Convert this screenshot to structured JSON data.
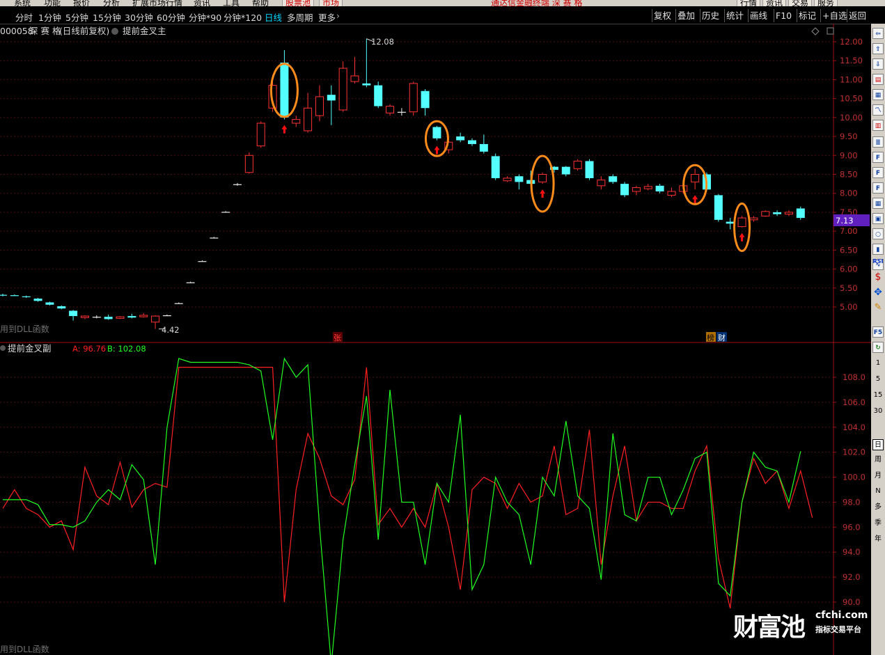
{
  "menu": {
    "items": [
      "系统",
      "功能",
      "报价",
      "分析",
      "扩展市场行情",
      "资讯",
      "工具",
      "帮助"
    ],
    "tab1": "股票池",
    "tab2": "市场",
    "title": "通达信金融终端 深 赛 格",
    "right": [
      "行情",
      "资讯",
      "交易",
      "服务"
    ]
  },
  "toolbar": {
    "periods": [
      "分时",
      "1分钟",
      "5分钟",
      "15分钟",
      "30分钟",
      "60分钟",
      "分钟*90",
      "分钟*120",
      "日线",
      "多周期",
      "更多"
    ],
    "active": "日线",
    "right_buttons": [
      "复权",
      "叠加",
      "历史",
      "统计",
      "画线",
      "F10",
      "标记",
      "+自选",
      "返回"
    ]
  },
  "main_panel": {
    "title_code": "000058",
    "title_name": "深 赛 格",
    "title_mode": "(日线前复权)",
    "indicator": "提前金叉主",
    "high_label": "12.08",
    "low_label": "4.42",
    "current_price": "7.13",
    "corner_text": "用到DLL函数",
    "marker_zhang": "张",
    "marker_bang": "榜",
    "marker_cai": "财"
  },
  "sub_panel": {
    "name": "提前金叉副",
    "a_label": "A: 96.76",
    "b_label": "B: 102.08",
    "corner_text": "用到DLL函数"
  },
  "sidebar": {
    "period_keys": [
      "1",
      "5",
      "15",
      "30",
      "日",
      "周",
      "月",
      "N",
      "多",
      "季",
      "年"
    ],
    "selected": "日",
    "icons": [
      "RSI",
      "F5"
    ]
  },
  "watermark": {
    "brand": "财富池",
    "url": "cfchi.com",
    "slogan": "指标交易平台"
  },
  "colors": {
    "up": "#ff3232",
    "down": "#54ffff",
    "line_a": "#ff2020",
    "line_b": "#20ff20",
    "highlight": "#ff8c1a"
  },
  "chart_data": [
    {
      "type": "candlestick",
      "title": "000058 深 赛 格 (日线前复权) 提前金叉主",
      "y_ticks": [
        "12.00",
        "11.50",
        "11.00",
        "10.50",
        "10.00",
        "9.50",
        "9.00",
        "8.50",
        "8.00",
        "7.50",
        "7.00",
        "6.50",
        "6.00",
        "5.50",
        "5.00"
      ],
      "ylim": [
        4.3,
        12.5
      ],
      "annotations": {
        "max": 12.08,
        "min": 4.42,
        "last": 7.13
      },
      "candles": [
        [
          5.32,
          5.3,
          5.35,
          5.28
        ],
        [
          5.31,
          5.3,
          5.33,
          5.29
        ],
        [
          5.28,
          5.26,
          5.3,
          5.24
        ],
        [
          5.22,
          5.16,
          5.24,
          5.14
        ],
        [
          5.12,
          5.06,
          5.14,
          5.04
        ],
        [
          5.02,
          4.96,
          5.04,
          4.94
        ],
        [
          4.9,
          4.76,
          4.92,
          4.64
        ],
        [
          4.72,
          4.76,
          4.78,
          4.68
        ],
        [
          4.74,
          4.74,
          4.78,
          4.7
        ],
        [
          4.74,
          4.68,
          4.8,
          4.66
        ],
        [
          4.7,
          4.74,
          4.76,
          4.68
        ],
        [
          4.76,
          4.72,
          4.82,
          4.7
        ],
        [
          4.74,
          4.78,
          4.84,
          4.72
        ],
        [
          4.6,
          4.76,
          4.78,
          4.42
        ],
        [
          4.78,
          4.78,
          4.8,
          4.76
        ],
        [
          5.1,
          5.1,
          5.12,
          5.1
        ],
        [
          5.65,
          5.65,
          5.67,
          5.65
        ],
        [
          6.21,
          6.21,
          6.23,
          6.21
        ],
        [
          6.83,
          6.83,
          6.85,
          6.83
        ],
        [
          7.51,
          7.51,
          7.53,
          7.51
        ],
        [
          8.24,
          8.24,
          8.27,
          8.2
        ],
        [
          8.55,
          9.0,
          9.08,
          8.52
        ],
        [
          9.25,
          9.85,
          9.9,
          9.2
        ],
        [
          10.25,
          10.85,
          10.95,
          10.15
        ],
        [
          11.45,
          10.0,
          11.78,
          9.95
        ],
        [
          9.85,
          9.95,
          10.05,
          9.75
        ],
        [
          9.65,
          10.25,
          10.65,
          9.6
        ],
        [
          10.05,
          10.55,
          10.85,
          9.9
        ],
        [
          10.6,
          10.45,
          10.85,
          9.8
        ],
        [
          10.2,
          11.3,
          11.48,
          10.15
        ],
        [
          10.95,
          11.1,
          11.6,
          10.9
        ],
        [
          10.9,
          10.85,
          12.08,
          10.8
        ],
        [
          10.85,
          10.3,
          10.95,
          10.25
        ],
        [
          10.12,
          10.3,
          10.35,
          10.05
        ],
        [
          10.15,
          10.15,
          10.25,
          10.05
        ],
        [
          10.15,
          10.9,
          10.95,
          10.05
        ],
        [
          10.7,
          10.25,
          10.75,
          10.05
        ],
        [
          9.75,
          9.45,
          9.78,
          9.4
        ],
        [
          9.15,
          9.35,
          9.5,
          9.05
        ],
        [
          9.5,
          9.4,
          9.6,
          9.35
        ],
        [
          9.4,
          9.3,
          9.45,
          9.25
        ],
        [
          9.3,
          9.1,
          9.55,
          9.05
        ],
        [
          8.98,
          8.4,
          9.05,
          8.35
        ],
        [
          8.33,
          8.4,
          8.45,
          8.3
        ],
        [
          8.45,
          8.3,
          8.5,
          8.1
        ],
        [
          8.35,
          8.25,
          8.6,
          8.2
        ],
        [
          8.3,
          8.5,
          8.55,
          8.25
        ],
        [
          8.7,
          8.62,
          8.72,
          8.55
        ],
        [
          8.7,
          8.5,
          8.72,
          8.45
        ],
        [
          8.65,
          8.85,
          8.9,
          8.6
        ],
        [
          8.85,
          8.4,
          8.9,
          8.35
        ],
        [
          8.2,
          8.35,
          8.45,
          8.1
        ],
        [
          8.45,
          8.3,
          8.5,
          8.25
        ],
        [
          8.25,
          7.95,
          8.3,
          7.9
        ],
        [
          8.05,
          8.15,
          8.2,
          7.95
        ],
        [
          8.12,
          8.18,
          8.25,
          8.08
        ],
        [
          8.2,
          8.05,
          8.25,
          8.0
        ],
        [
          7.95,
          8.05,
          8.15,
          7.9
        ],
        [
          8.05,
          8.2,
          8.25,
          8.0
        ],
        [
          8.3,
          8.5,
          8.65,
          8.1
        ],
        [
          8.5,
          8.1,
          8.55,
          8.05
        ],
        [
          7.95,
          7.3,
          7.98,
          7.25
        ],
        [
          7.25,
          7.2,
          7.35,
          7.05
        ],
        [
          7.12,
          7.35,
          7.4,
          7.1
        ],
        [
          7.3,
          7.35,
          7.4,
          7.25
        ],
        [
          7.4,
          7.52,
          7.55,
          7.38
        ],
        [
          7.5,
          7.45,
          7.55,
          7.4
        ],
        [
          7.45,
          7.5,
          7.55,
          7.4
        ],
        [
          7.6,
          7.35,
          7.65,
          7.3
        ]
      ],
      "highlighted_candles": [
        24,
        37,
        46,
        59,
        63
      ]
    },
    {
      "type": "line",
      "title": "提前金叉副",
      "y_ticks": [
        "108.0",
        "106.0",
        "104.0",
        "102.0",
        "100.0",
        "98.0",
        "96.0",
        "94.0",
        "92.0",
        "90.0"
      ],
      "ylim": [
        88.0,
        110.5
      ],
      "series": [
        {
          "name": "A",
          "last": 96.76,
          "values": [
            97.5,
            99.0,
            97.5,
            97.0,
            96.0,
            96.5,
            94.2,
            100.8,
            98.5,
            97.8,
            101.2,
            97.6,
            99.0,
            99.5,
            99.2,
            108.8,
            108.8,
            108.8,
            108.8,
            108.8,
            108.8,
            108.8,
            108.8,
            108.8,
            90.0,
            99.0,
            103.5,
            101.5,
            98.5,
            97.8,
            99.8,
            108.8,
            96.2,
            97.5,
            96.0,
            97.5,
            96.0,
            99.5,
            96.0,
            91.0,
            99.0,
            100.0,
            99.5,
            97.5,
            99.5,
            98.0,
            98.5,
            102.5,
            97.0,
            97.5,
            103.8,
            93.0,
            98.5,
            102.5,
            96.5,
            98.0,
            98.0,
            97.5,
            97.5,
            100.5,
            102.5,
            93.5,
            89.5,
            98.0,
            101.5,
            99.5,
            100.5,
            97.5,
            100.5,
            96.76
          ]
        },
        {
          "name": "B",
          "last": 102.08,
          "values": [
            98.2,
            98.2,
            98.2,
            97.8,
            96.2,
            96.2,
            96.0,
            96.5,
            98.0,
            99.0,
            98.2,
            101.0,
            99.8,
            93.0,
            104.0,
            109.5,
            109.2,
            109.2,
            109.2,
            109.2,
            109.2,
            109.0,
            108.5,
            103.0,
            109.5,
            108.0,
            109.0,
            96.0,
            85.0,
            95.0,
            101.0,
            106.5,
            95.0,
            107.0,
            98.0,
            98.0,
            93.0,
            99.5,
            98.0,
            105.0,
            91.0,
            93.0,
            100.0,
            98.0,
            97.0,
            93.0,
            100.0,
            98.5,
            104.5,
            98.5,
            97.5,
            91.8,
            103.5,
            97.0,
            96.5,
            100.0,
            100.0,
            97.0,
            99.0,
            101.5,
            102.0,
            91.5,
            90.5,
            98.0,
            102.0,
            100.8,
            100.5,
            98.0,
            102.08
          ]
        }
      ]
    }
  ]
}
